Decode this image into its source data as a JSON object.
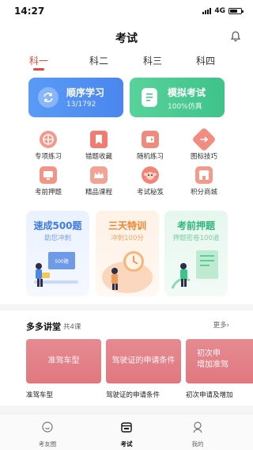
{
  "status_bar": {
    "time": "14:27",
    "network": "4G"
  },
  "nav": {
    "title": "考试",
    "bell_icon": "bell-icon"
  },
  "subject_tabs": [
    {
      "label": "科一",
      "active": true
    },
    {
      "label": "科二",
      "active": false
    },
    {
      "label": "科三",
      "active": false
    },
    {
      "label": "科四",
      "active": false
    }
  ],
  "main_cards": [
    {
      "title": "顺序学习",
      "subtitle": "13/1792",
      "icon": "sync-icon",
      "color": "#4a86ee"
    },
    {
      "title": "模拟考试",
      "subtitle": "100%仿真",
      "icon": "exam-paper-icon",
      "color": "#3ec38a"
    }
  ],
  "features": [
    {
      "label": "专项练习",
      "icon": "target-icon",
      "color": "#f39a8c"
    },
    {
      "label": "错题收藏",
      "icon": "bookmark-icon",
      "color": "#f27a6e"
    },
    {
      "label": "随机练习",
      "icon": "shuffle-icon",
      "color": "#f08a7e"
    },
    {
      "label": "图标技巧",
      "icon": "road-sign-icon",
      "color": "#f28c80"
    },
    {
      "label": "考前押题",
      "icon": "screen-icon",
      "color": "#f29486"
    },
    {
      "label": "精品课程",
      "icon": "crown-icon",
      "color": "#f4a294"
    },
    {
      "label": "考试秘笈",
      "icon": "monkey-icon",
      "color": "#f28478"
    },
    {
      "label": "积分商城",
      "icon": "shop-icon",
      "color": "#f39a8c"
    }
  ],
  "promos": [
    {
      "title": "速成500题",
      "subtitle": "助您冲刺",
      "badge": "500题",
      "title_color": "#3d7be6",
      "sub_color": "#7aa3ec"
    },
    {
      "title": "三天特训",
      "subtitle": "冲刺100分",
      "title_color": "#f0842c",
      "sub_color": "#f2a868"
    },
    {
      "title": "考前押题",
      "subtitle": "押题密卷100道",
      "title_color": "#2eb87a",
      "sub_color": "#7ccfa6"
    }
  ],
  "lectures": {
    "title": "多多讲堂",
    "count": "共4课",
    "more": "更多",
    "items": [
      {
        "card_text": "准驾车型",
        "caption": "准驾车型"
      },
      {
        "card_text": "驾驶证的申请条件",
        "caption": "驾驶证的申请条件"
      },
      {
        "card_text": "初次申\n增加准驾",
        "caption": "初次申请及增加"
      }
    ]
  },
  "tab_bar": [
    {
      "label": "考友圈",
      "icon": "chat-bubble-icon",
      "active": false
    },
    {
      "label": "考试",
      "icon": "calendar-icon",
      "active": true
    },
    {
      "label": "我的",
      "icon": "person-icon",
      "active": false
    }
  ]
}
